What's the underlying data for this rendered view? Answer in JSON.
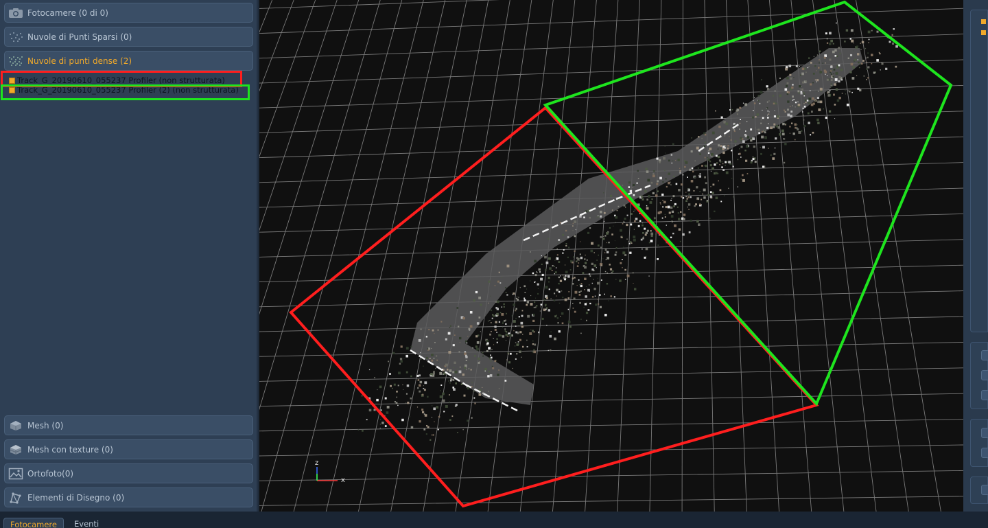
{
  "left_panel": {
    "sections_top": [
      {
        "label": "Fotocamere (0 di 0)",
        "icon": "camera-icon"
      },
      {
        "label": "Nuvole di Punti Sparsi (0)",
        "icon": "sparse-cloud-icon"
      },
      {
        "label": "Nuvole di punti dense (2)",
        "icon": "dense-cloud-icon"
      }
    ],
    "tree_items": [
      {
        "label": "Track_G_20190610_055237 Profiler (non strutturata)"
      },
      {
        "label": "Track_G_20190610_055237 Profiler (2) (non strutturata)"
      }
    ],
    "sections_bottom": [
      {
        "label": "Mesh (0)",
        "icon": "mesh-icon"
      },
      {
        "label": "Mesh con texture (0)",
        "icon": "textured-mesh-icon"
      },
      {
        "label": "Ortofoto(0)",
        "icon": "orthophoto-icon"
      },
      {
        "label": "Elementi di Disegno (0)",
        "icon": "drawing-elements-icon"
      }
    ]
  },
  "viewport": {
    "axis_z": "z",
    "axis_x": "x",
    "highlight_colors": {
      "red": "#ff1e1e",
      "green": "#1ee51e"
    }
  },
  "bottom_tabs": [
    {
      "label": "Fotocamere",
      "active": true
    },
    {
      "label": "Eventi",
      "active": false
    }
  ],
  "colors": {
    "accent": "#f0a92b",
    "panel": "#2e3f54"
  }
}
